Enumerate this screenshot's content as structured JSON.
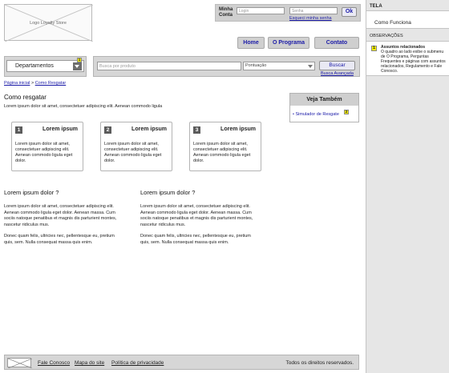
{
  "logo": {
    "text": "Logo Loyalty Store"
  },
  "login": {
    "label": "Minha Conta",
    "user_placeholder": "Login",
    "pass_placeholder": "Senha",
    "ok_label": "Ok",
    "forgot_label": "Esqueci minha senha"
  },
  "nav": {
    "home": "Home",
    "program": "O Programa",
    "contact": "Contato"
  },
  "departments": {
    "label": "Departamentos",
    "note_number": "1"
  },
  "search": {
    "placeholder": "Busca por produto",
    "sort_value": "Pontuação",
    "button": "Buscar",
    "advanced": "Busca Avançada"
  },
  "breadcrumb": {
    "home": "Página inicial",
    "separator": ">",
    "current": "Como Resgatar"
  },
  "main": {
    "title": "Como resgatar",
    "intro": "Lorem ipsum dolor sit amet, consectetuer adipiscing elit. Aenean commodo ligula",
    "steps": [
      {
        "number": "1",
        "title": "Lorem ipsum",
        "text": "Lorem ipsum dolor sit amet, consectetuer adipiscing elit. Aenean commodo ligula eget dolor."
      },
      {
        "number": "2",
        "title": "Lorem ipsum",
        "text": "Lorem ipsum dolor sit amet, consectetuer adipiscing elit. Aenean commodo ligula eget dolor."
      },
      {
        "number": "3",
        "title": "Lorem ipsum",
        "text": "Lorem ipsum dolor sit amet, consectetuer adipiscing elit. Aenean commodo ligula eget dolor."
      }
    ],
    "articles": [
      {
        "heading": "Lorem ipsum dolor ?",
        "p1": "Lorem ipsum dolor sit amet, consectetuer adipiscing elit. Aenean commodo ligula eget dolor. Aenean massa. Cum sociis natoque penatibus et magnis dis parturient montes, nascetur ridiculus mus.",
        "p2": "Donec quam felis, ultricies nec, pellentesque eu, pretium quis, sem. Nulla consequat massa quis enim."
      },
      {
        "heading": "Lorem ipsum dolor ?",
        "p1": "Lorem ipsum dolor sit amet, consectetuer adipiscing elit. Aenean commodo ligula eget dolor. Aenean massa. Cum sociis natoque penatibus et magnis dis parturient montes, nascetur ridiculus mus.",
        "p2": "Donec quam felis, ultricies nec, pellentesque eu, pretium quis, sem. Nulla consequat massa quis enim."
      }
    ]
  },
  "see_also": {
    "title": "Veja Também",
    "link": "• Simulador de Resgate",
    "note_number": "2"
  },
  "footer": {
    "contact": "Fale Conosco",
    "sitemap": "Mapa do site",
    "privacy": "Política de privacidade",
    "rights": "Todos os direitos reservados."
  },
  "annotations": {
    "screen_header": "TELA",
    "screen_name": "Como Funciona",
    "notes_header": "OBSERVAÇÕES",
    "notes": [
      {
        "number": "1",
        "title": "Assuntos relacionados",
        "text": "O quadro ao lado exibe o submenu de O Programa, Perguntas Frequentes e páginas com assuntos relacionados, Regulamento e Fale Conosco."
      }
    ]
  },
  "colors": {
    "link": "#1a1aa8",
    "note_badge": "#f3ec00",
    "panel_bg": "#e6e6e6",
    "bar_bg": "#d6d6d6"
  }
}
